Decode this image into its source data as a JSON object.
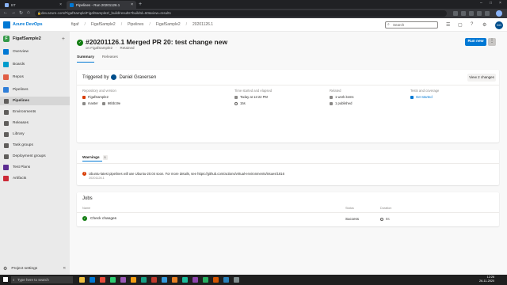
{
  "browser": {
    "tabs": [
      {
        "label": "BT"
      },
      {
        "label": "Pipelines - Run 20201126.1"
      }
    ],
    "url": "dev.azure.com/FigafSample/FigafSample2/_build/results?buildId=60&view=results"
  },
  "ado": {
    "product": "Azure DevOps",
    "breadcrumb": [
      "figaf",
      "FigafSample2",
      "Pipelines",
      "FigafSample2",
      "20201126.1"
    ],
    "search_placeholder": "Search",
    "user_initials": "DG"
  },
  "sidebar": {
    "project_initial": "F",
    "project_name": "FigafSample2",
    "items": [
      {
        "label": "Overview",
        "color": "#0078d4"
      },
      {
        "label": "Boards",
        "color": "#009ccc"
      },
      {
        "label": "Repos",
        "color": "#e05d44"
      },
      {
        "label": "Pipelines",
        "color": "#2f7ed8"
      },
      {
        "label": "Pipelines"
      },
      {
        "label": "Environments"
      },
      {
        "label": "Releases"
      },
      {
        "label": "Library"
      },
      {
        "label": "Task groups"
      },
      {
        "label": "Deployment groups"
      },
      {
        "label": "Test Plans",
        "color": "#5c2d91"
      },
      {
        "label": "Artifacts",
        "color": "#cc2936"
      }
    ],
    "footer": "Project settings"
  },
  "run": {
    "title": "#20201126.1 Merged PR 20: test change new",
    "subtitle_on": "on FigafSample2",
    "subtitle_retained": "Retained",
    "run_new": "Run new",
    "more": "⋮",
    "tabs": [
      "Summary",
      "Releases"
    ]
  },
  "summary": {
    "triggered_by": "Triggered by",
    "user": "Daniel Graversen",
    "view_changes": "View 2 changes",
    "repo_head": "Repository and version",
    "repo": "FigafSample2",
    "branch": "master",
    "commit": "66bb19e",
    "time_head": "Time started and elapsed",
    "started": "Today at 12:22 PM",
    "elapsed": "15s",
    "related_head": "Related",
    "work_items": "1 work items",
    "published": "1 published",
    "tests_head": "Tests and coverage",
    "tests": "Get started"
  },
  "warnings": {
    "title": "Warnings",
    "count": "1",
    "message": "Ubuntu-latest pipelines will use Ubuntu-20.04 soon. For more details, see https://github.com/actions/virtual-environments/issues/1816",
    "run": "20201126.1"
  },
  "jobs": {
    "title": "Jobs",
    "columns": [
      "Name",
      "Status",
      "Duration"
    ],
    "rows": [
      {
        "name": "Check changes",
        "status": "Success",
        "duration": "8s"
      }
    ]
  },
  "taskbar": {
    "search_placeholder": "Type here to search",
    "time": "12:26",
    "date": "26-11-2020",
    "app_colors": [
      "#f0c040",
      "#0078d4",
      "#e74c3c",
      "#2ecc71",
      "#9b59b6",
      "#f39c12",
      "#16a085",
      "#c0392b",
      "#3498db",
      "#e67e22",
      "#1abc9c",
      "#8e44ad",
      "#27ae60",
      "#d35400",
      "#2980b9",
      "#7f8c8d"
    ]
  }
}
